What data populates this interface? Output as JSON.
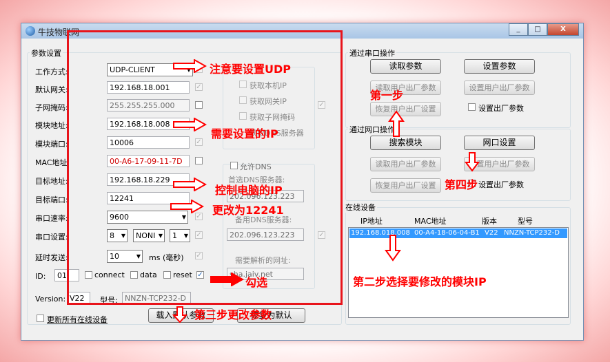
{
  "window": {
    "title": "牛技物联网",
    "min_label": "_",
    "max_label": "□",
    "close_label": "X"
  },
  "params": {
    "group_title": "参数设置",
    "work_mode_label": "工作方式:",
    "work_mode_value": "UDP-CLIENT",
    "gateway_label": "默认网关:",
    "gateway_value": "192.168.18.001",
    "subnet_label": "子网掩码:",
    "subnet_value": "255.255.255.000",
    "module_addr_label": "模块地址:",
    "module_addr_value": "192.168.18.008",
    "module_port_label": "模块端口:",
    "module_port_value": "10006",
    "mac_label": "MAC地址:",
    "mac_value": "00-A6-17-09-11-7D",
    "target_addr_label": "目标地址:",
    "target_addr_value": "192.168.18.229",
    "target_port_label": "目标端口:",
    "target_port_value": "12241",
    "baud_label": "串口速率:",
    "baud_value": "9600",
    "serial_label": "串口设置:",
    "databits_value": "8",
    "parity_value": "NONI",
    "stopbits_value": "1",
    "delay_label": "延时发送:",
    "delay_value": "10",
    "delay_unit": "ms (毫秒)",
    "id_label": "ID:",
    "id_value": "01",
    "connect_label": "connect",
    "data_label": "data",
    "reset_label": "reset",
    "version_label": "Version:",
    "version_value": "V22",
    "model_label": "型号:",
    "model_value": "NNZN-TCP232-D",
    "update_all_label": "更新所有在线设备",
    "load_btn": "载入默认参数",
    "factory_btn": "恢复为默认",
    "get_local_ip": "获取本机IP",
    "get_gateway_ip": "获取网关IP",
    "get_subnet": "获取子网掩码",
    "get_dns": "获取DNS服务器",
    "allow_dns": "允许DNS",
    "primary_dns_label": "首选DNS服务器:",
    "primary_dns_value": "202.096.123.223",
    "secondary_dns_label": "备用DNS服务器:",
    "secondary_dns_value": "202.096.123.223",
    "resolve_label": "需要解析的网址:",
    "resolve_value": "sha.jaiv.net"
  },
  "serial_ops": {
    "title": "通过串口操作",
    "read_params": "读取参数",
    "set_params": "设置参数",
    "read_user_factory": "读取用户出厂参数",
    "set_user_factory": "设置用户出厂参数",
    "restore_factory": "恢复用户出厂设置",
    "set_as_factory": "设置出厂参数"
  },
  "net_ops": {
    "title": "通过网口操作",
    "search_modules": "搜索模块",
    "net_settings": "网口设置",
    "read_user_factory": "读取用户出厂参数",
    "set_user_factory": "设置用户出厂参数",
    "restore_factory": "恢复用户出厂设置",
    "set_as_factory": "设置出厂参数"
  },
  "online": {
    "title": "在线设备",
    "headers": [
      "IP地址",
      "MAC地址",
      "版本",
      "型号"
    ],
    "rows": [
      {
        "ip": "192.168.018.008",
        "mac": "00-A4-18-06-04-B1",
        "ver": "V22",
        "model": "NNZN-TCP232-D"
      }
    ]
  },
  "annotations": {
    "udp": "注意要设置UDP",
    "ip_needed": "需要设置的IP",
    "control_ip": "控制电脑的IP",
    "change_port": "更改为12241",
    "check": "勾选",
    "step1": "第一步",
    "step2": "第二步选择要修改的模块IP",
    "step3": "第三步更改参数",
    "step4": "第四步"
  },
  "colors": {
    "annotation": "#ff0000",
    "selection": "#3399ff"
  }
}
